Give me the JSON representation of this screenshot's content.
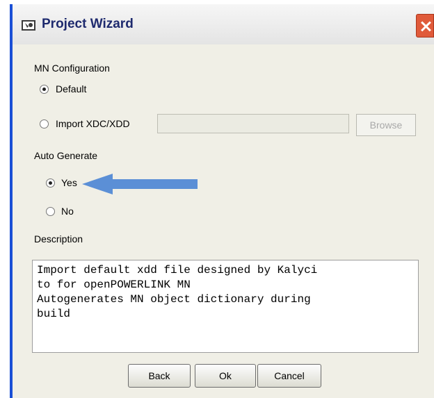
{
  "window": {
    "title": "Project Wizard",
    "title_icon": "wizard-app-icon",
    "close_icon": "close-icon"
  },
  "mn_configuration": {
    "label": "MN Configuration",
    "options": [
      {
        "label": "Default",
        "selected": true
      },
      {
        "label": "Import XDC/XDD",
        "selected": false
      }
    ],
    "xdc_path_value": "",
    "browse_label": "Browse"
  },
  "auto_generate": {
    "label": "Auto Generate",
    "options": [
      {
        "label": "Yes",
        "selected": true
      },
      {
        "label": "No",
        "selected": false
      }
    ],
    "annotation": "arrow-pointing-icon",
    "annotation_color": "#5b8fd6"
  },
  "description": {
    "label": "Description",
    "text": "Import default xdd file designed by Kalyci\nto for openPOWERLINK MN\nAutogenerates MN object dictionary during\nbuild"
  },
  "buttons": {
    "back": "Back",
    "ok": "Ok",
    "cancel": "Cancel"
  },
  "colors": {
    "title_text": "#1e2a6e",
    "window_border": "#1a4fd6",
    "close_button": "#e05a3a",
    "dialog_bg": "#f0efe6"
  }
}
